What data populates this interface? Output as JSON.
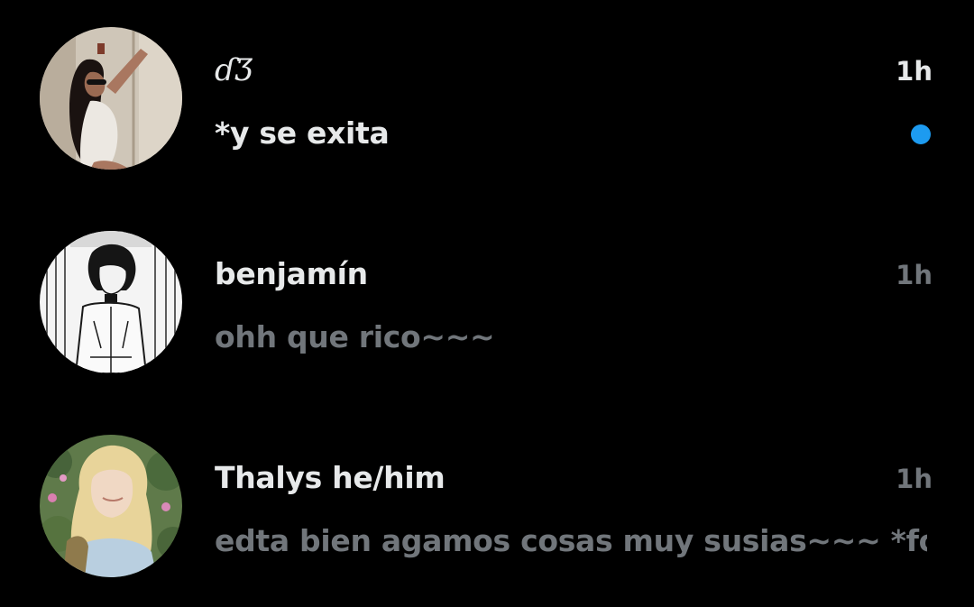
{
  "theme": {
    "background": "#000000",
    "primary_text": "#e7e9ea",
    "secondary_text": "#71767b",
    "unread_accent": "#1d9bf0"
  },
  "conversations": [
    {
      "name": "ɗƷ",
      "time": "1h",
      "preview": "*y se exita",
      "unread": true,
      "avatar_icon": "user-photo-icon"
    },
    {
      "name": "benjamín",
      "time": "1h",
      "preview": "ohh que rico~~~",
      "unread": false,
      "avatar_icon": "user-photo-icon"
    },
    {
      "name": "Thalys he/him",
      "time": "1h",
      "preview": "edta bien agamos cosas muy susias~~~ *fo...",
      "unread": false,
      "avatar_icon": "user-photo-icon"
    }
  ]
}
